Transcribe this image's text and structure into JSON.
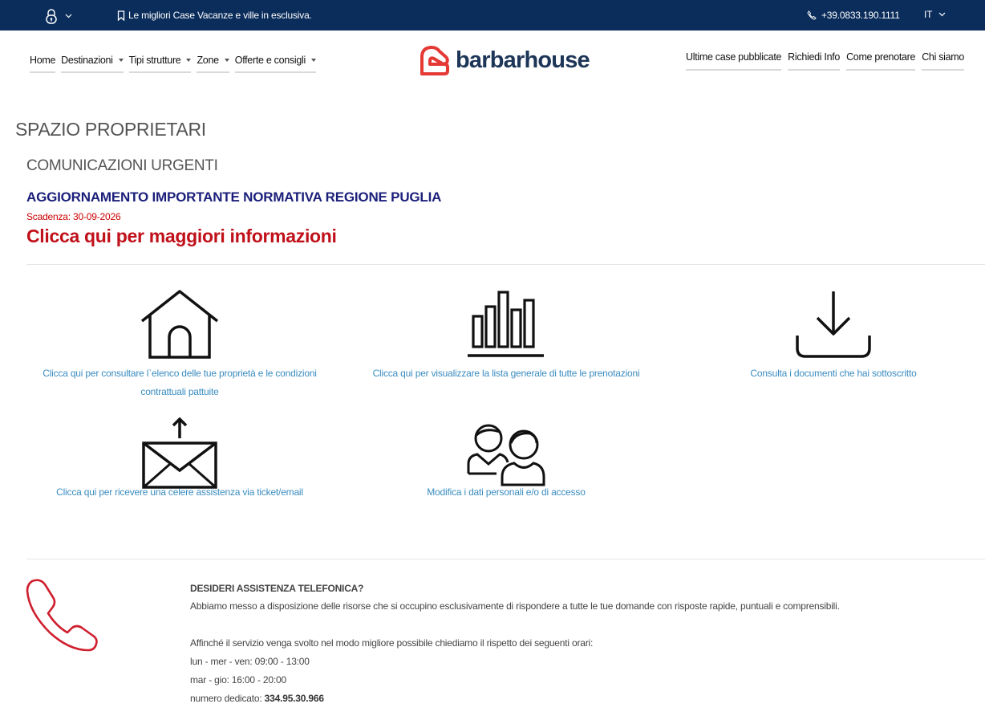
{
  "topbar": {
    "tagline": "Le migliori Case Vacanze e ville in esclusiva.",
    "phone": "+39.0833.190.1111",
    "lang": "IT"
  },
  "nav": {
    "left": [
      {
        "label": "Home",
        "dropdown": false
      },
      {
        "label": "Destinazioni",
        "dropdown": true
      },
      {
        "label": "Tipi strutture",
        "dropdown": true
      },
      {
        "label": "Zone",
        "dropdown": true
      },
      {
        "label": "Offerte e consigli",
        "dropdown": true
      }
    ],
    "right": [
      "Ultime case pubblicate",
      "Richiedi Info",
      "Come prenotare",
      "Chi siamo"
    ]
  },
  "logo": {
    "text": "barbarhouse",
    "color": "#e53935"
  },
  "page": {
    "title": "SPAZIO PROPRIETARI",
    "section_title": "COMUNICAZIONI URGENTI",
    "alert_title": "AGGIORNAMENTO IMPORTANTE NORMATIVA REGIONE PUGLIA",
    "deadline": "Scadenza: 30-09-2026",
    "more_info": "Clicca qui per maggiori informazioni"
  },
  "tiles": [
    {
      "icon": "house-icon",
      "label_line1": "Clicca qui per consultare l`elenco delle tue proprietà e le condizioni",
      "label_line2": "contrattuali pattuite"
    },
    {
      "icon": "bar-chart-icon",
      "label_line1": "Clicca qui per visualizzare la lista generale di tutte le prenotazioni",
      "label_line2": ""
    },
    {
      "icon": "download-icon",
      "label_line1": "Consulta i documenti che hai sottoscritto",
      "label_line2": ""
    },
    {
      "icon": "mail-upload-icon",
      "label_line1": "Clicca qui per ricevere una celere assistenza via ticket/email",
      "label_line2": ""
    },
    {
      "icon": "users-icon",
      "label_line1": "Modifica i dati personali e/o di accesso",
      "label_line2": ""
    }
  ],
  "assist": {
    "heading": "DESIDERI ASSISTENZA TELEFONICA?",
    "intro": "Abbiamo messo a disposizione delle risorse che si occupino esclusivamente di rispondere a tutte le tue domande con risposte rapide, puntuali e comprensibili.",
    "hours_intro": "Affinché il servizio venga svolto nel modo migliore possibile chiediamo il rispetto dei seguenti orari:",
    "hours_1": "lun - mer - ven: 09:00 - 13:00",
    "hours_2": "mar - gio: 16:00 - 20:00",
    "number_label": "numero dedicato: ",
    "number": "334.95.30.966"
  },
  "colors": {
    "topbar": "#0b2d5b",
    "link": "#3a8cc0",
    "alert": "#c0101a",
    "alert_title": "#1b1f7a"
  }
}
